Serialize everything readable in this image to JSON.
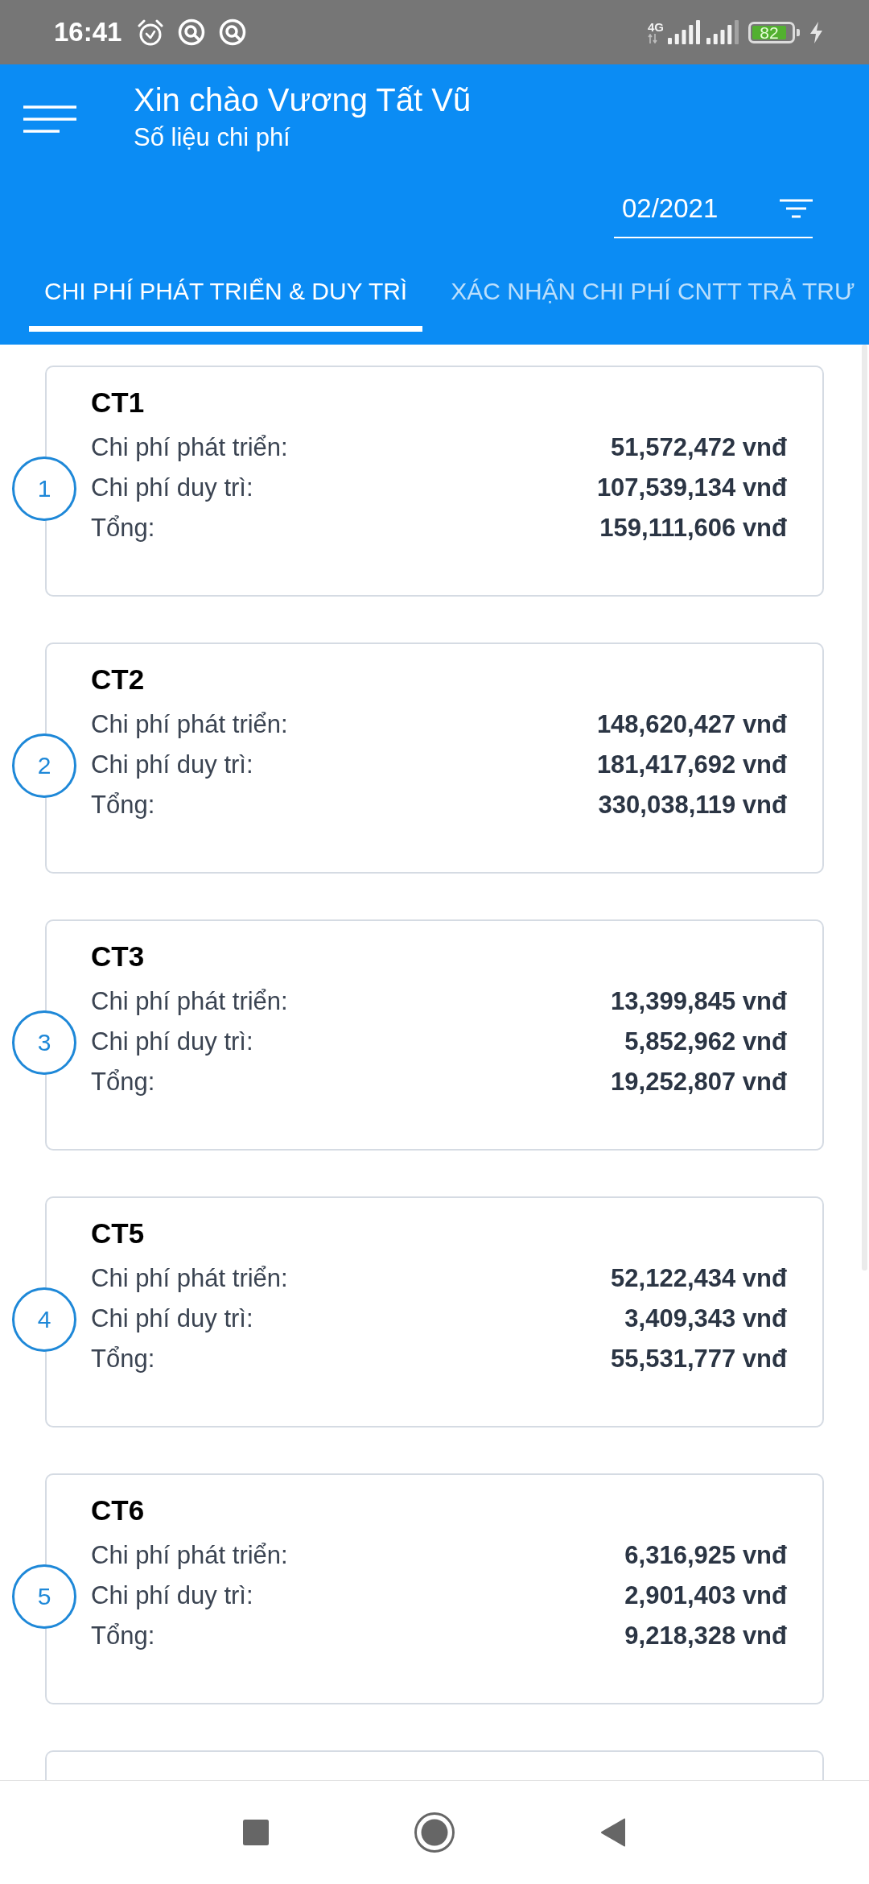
{
  "status_bar": {
    "time": "16:41",
    "network": "4G",
    "battery": "82"
  },
  "header": {
    "title": "Xin chào Vương Tất Vũ",
    "subtitle": "Số liệu chi phí",
    "month": "02/2021"
  },
  "tabs": [
    {
      "label": "CHI PHÍ PHÁT TRIỂN & DUY TRÌ",
      "selected": true
    },
    {
      "label": "XÁC NHẬN CHI PHÍ CNTT TRẢ TRƯ",
      "selected": false
    }
  ],
  "cards": [
    {
      "number": "1",
      "title": "CT1",
      "rows": [
        {
          "label": "Chi phí phát triển:",
          "value": "51,572,472 vnđ"
        },
        {
          "label": "Chi phí duy trì:",
          "value": "107,539,134 vnđ"
        },
        {
          "label": "Tổng:",
          "value": "159,111,606 vnđ"
        }
      ]
    },
    {
      "number": "2",
      "title": "CT2",
      "rows": [
        {
          "label": "Chi phí phát triển:",
          "value": "148,620,427 vnđ"
        },
        {
          "label": "Chi phí duy trì:",
          "value": "181,417,692 vnđ"
        },
        {
          "label": "Tổng:",
          "value": "330,038,119 vnđ"
        }
      ]
    },
    {
      "number": "3",
      "title": "CT3",
      "rows": [
        {
          "label": "Chi phí phát triển:",
          "value": "13,399,845 vnđ"
        },
        {
          "label": "Chi phí duy trì:",
          "value": "5,852,962 vnđ"
        },
        {
          "label": "Tổng:",
          "value": "19,252,807 vnđ"
        }
      ]
    },
    {
      "number": "4",
      "title": "CT5",
      "rows": [
        {
          "label": "Chi phí phát triển:",
          "value": "52,122,434 vnđ"
        },
        {
          "label": "Chi phí duy trì:",
          "value": "3,409,343 vnđ"
        },
        {
          "label": "Tổng:",
          "value": "55,531,777 vnđ"
        }
      ]
    },
    {
      "number": "5",
      "title": "CT6",
      "rows": [
        {
          "label": "Chi phí phát triển:",
          "value": "6,316,925 vnđ"
        },
        {
          "label": "Chi phí duy trì:",
          "value": "2,901,403 vnđ"
        },
        {
          "label": "Tổng:",
          "value": "9,218,328 vnđ"
        }
      ]
    }
  ]
}
